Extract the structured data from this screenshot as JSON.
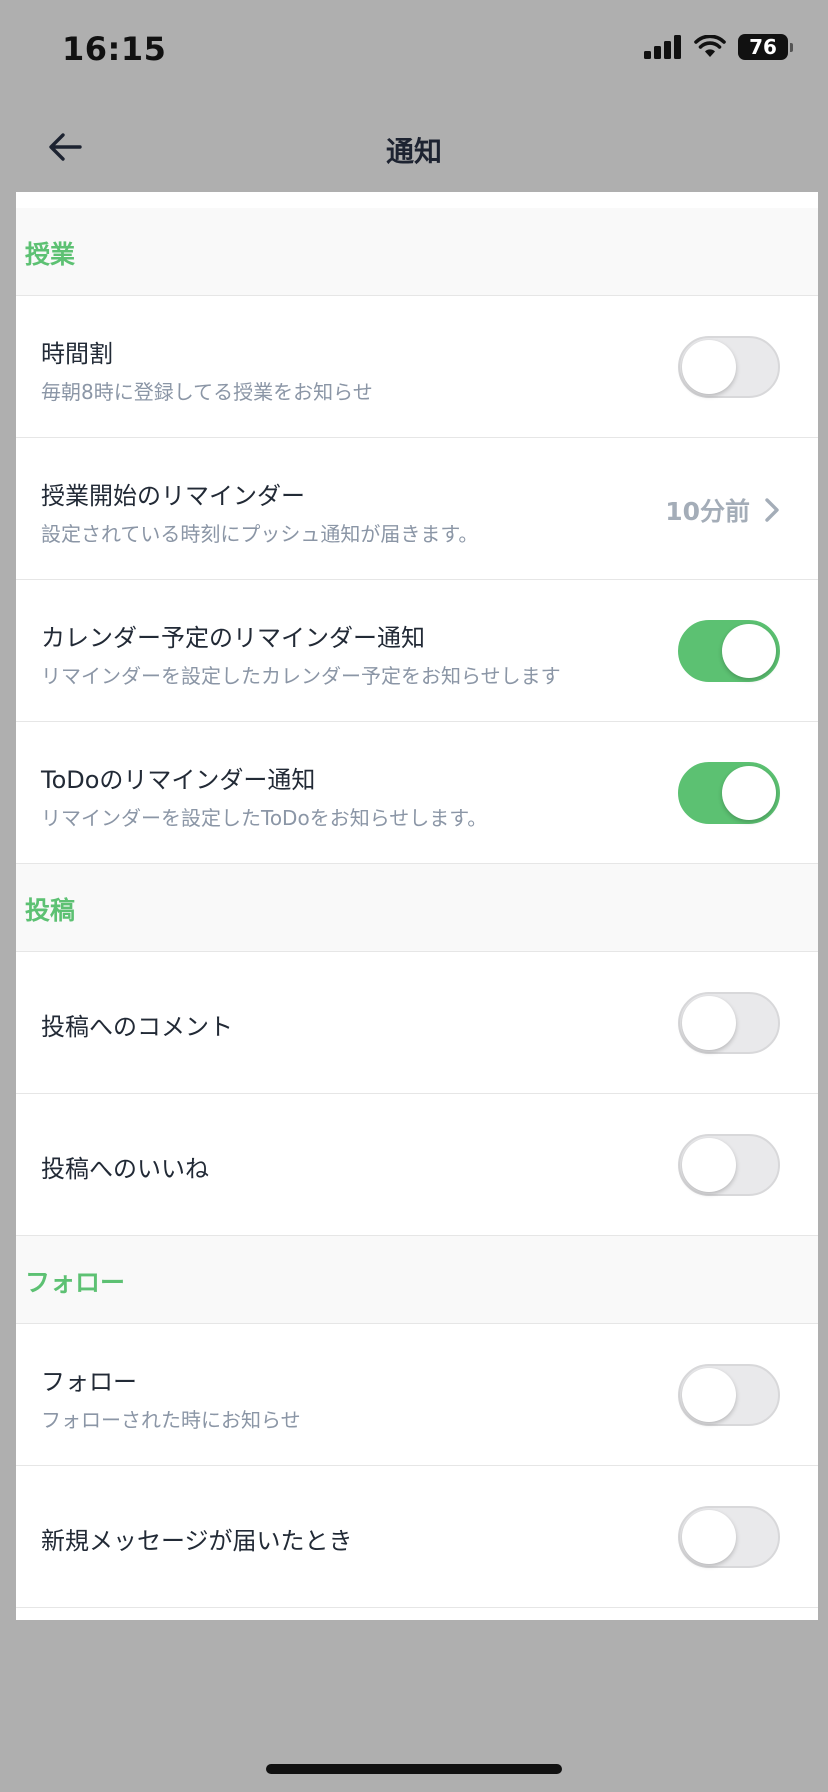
{
  "status_bar": {
    "time": "16:15",
    "battery": "76"
  },
  "nav": {
    "title": "通知"
  },
  "sections": [
    {
      "header": "授業",
      "rows": [
        {
          "title": "時間割",
          "subtitle": "毎朝8時に登録してる授業をお知らせ",
          "toggle": false
        },
        {
          "title": "授業開始のリマインダー",
          "subtitle": "設定されている時刻にプッシュ通知が届きます。",
          "value": "10分前"
        },
        {
          "title": "カレンダー予定のリマインダー通知",
          "subtitle": "リマインダーを設定したカレンダー予定をお知らせします",
          "toggle": true
        },
        {
          "title": "ToDoのリマインダー通知",
          "subtitle": "リマインダーを設定したToDoをお知らせします。",
          "toggle": true
        }
      ]
    },
    {
      "header": "投稿",
      "rows": [
        {
          "title": "投稿へのコメント",
          "toggle": false
        },
        {
          "title": "投稿へのいいね",
          "toggle": false
        }
      ]
    },
    {
      "header": "フォロー",
      "rows": [
        {
          "title": "フォロー",
          "subtitle": "フォローされた時にお知らせ",
          "toggle": false
        },
        {
          "title": "新規メッセージが届いたとき",
          "toggle": false
        }
      ]
    }
  ],
  "colors": {
    "accent": "#5cc172",
    "section_header": "#5dc173",
    "subtitle": "#8b96a6",
    "backdrop": "#afafaf"
  },
  "icons": {
    "back": "arrow-left-icon",
    "chevron": "chevron-right-icon",
    "signal": "cellular-signal-icon",
    "wifi": "wifi-icon",
    "battery": "battery-icon"
  }
}
